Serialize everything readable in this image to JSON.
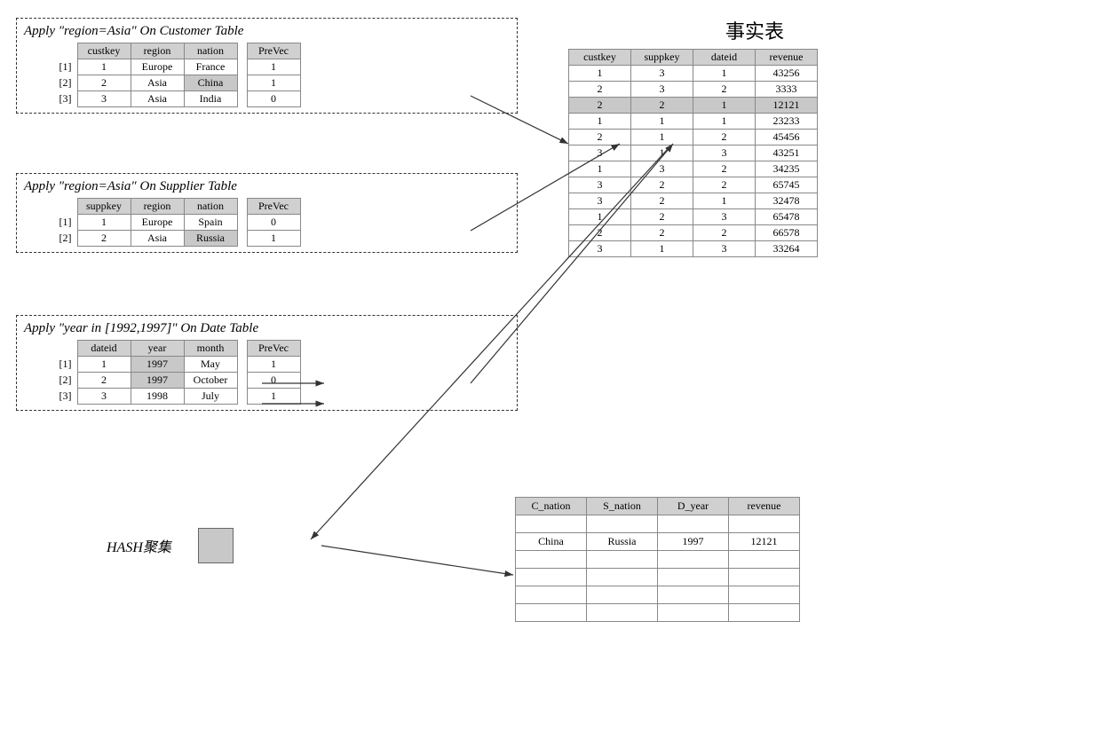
{
  "title_zh": "事实表",
  "sections": {
    "customer": {
      "title": "Apply  \"region=Asia\"  On Customer Table",
      "columns": [
        "custkey",
        "region",
        "nation"
      ],
      "prevec_header": "PreVec",
      "rows": [
        {
          "idx": "[1]",
          "custkey": "1",
          "region": "Europe",
          "nation": "France",
          "prevec": "1",
          "nation_shaded": false
        },
        {
          "idx": "[2]",
          "custkey": "2",
          "region": "Asia",
          "nation": "China",
          "prevec": "1",
          "nation_shaded": true
        },
        {
          "idx": "[3]",
          "custkey": "3",
          "region": "Asia",
          "nation": "India",
          "prevec": "0",
          "nation_shaded": false
        }
      ]
    },
    "supplier": {
      "title": "Apply  \"region=Asia\"  On Supplier Table",
      "columns": [
        "suppkey",
        "region",
        "nation"
      ],
      "prevec_header": "PreVec",
      "rows": [
        {
          "idx": "[1]",
          "suppkey": "1",
          "region": "Europe",
          "nation": "Spain",
          "prevec": "0",
          "nation_shaded": false
        },
        {
          "idx": "[2]",
          "suppkey": "2",
          "region": "Asia",
          "nation": "Russia",
          "prevec": "1",
          "nation_shaded": true
        }
      ]
    },
    "date": {
      "title": "Apply  \"year in [1992,1997]\"  On Date Table",
      "columns": [
        "dateid",
        "year",
        "month"
      ],
      "prevec_header": "PreVec",
      "rows": [
        {
          "idx": "[1]",
          "dateid": "1",
          "year": "1997",
          "month": "May",
          "prevec": "1",
          "year_shaded": true
        },
        {
          "idx": "[2]",
          "dateid": "2",
          "year": "1997",
          "month": "October",
          "prevec": "0",
          "year_shaded": true
        },
        {
          "idx": "[3]",
          "dateid": "3",
          "year": "1998",
          "month": "July",
          "prevec": "1",
          "year_shaded": false
        }
      ]
    }
  },
  "fact_table": {
    "columns": [
      "custkey",
      "suppkey",
      "dateid",
      "revenue"
    ],
    "rows": [
      {
        "custkey": "1",
        "suppkey": "3",
        "dateid": "1",
        "revenue": "43256",
        "shaded": false
      },
      {
        "custkey": "2",
        "suppkey": "3",
        "dateid": "2",
        "revenue": "3333",
        "shaded": false
      },
      {
        "custkey": "2",
        "suppkey": "2",
        "dateid": "1",
        "revenue": "12121",
        "shaded": true
      },
      {
        "custkey": "1",
        "suppkey": "1",
        "dateid": "1",
        "revenue": "23233",
        "shaded": false
      },
      {
        "custkey": "2",
        "suppkey": "1",
        "dateid": "2",
        "revenue": "45456",
        "shaded": false
      },
      {
        "custkey": "3",
        "suppkey": "1",
        "dateid": "3",
        "revenue": "43251",
        "shaded": false
      },
      {
        "custkey": "1",
        "suppkey": "3",
        "dateid": "2",
        "revenue": "34235",
        "shaded": false
      },
      {
        "custkey": "3",
        "suppkey": "2",
        "dateid": "2",
        "revenue": "65745",
        "shaded": false
      },
      {
        "custkey": "3",
        "suppkey": "2",
        "dateid": "1",
        "revenue": "32478",
        "shaded": false
      },
      {
        "custkey": "1",
        "suppkey": "2",
        "dateid": "3",
        "revenue": "65478",
        "shaded": false
      },
      {
        "custkey": "2",
        "suppkey": "2",
        "dateid": "2",
        "revenue": "66578",
        "shaded": false
      },
      {
        "custkey": "3",
        "suppkey": "1",
        "dateid": "3",
        "revenue": "33264",
        "shaded": false
      }
    ]
  },
  "hash_label": "HASH聚集",
  "result_table": {
    "columns": [
      "C_nation",
      "S_nation",
      "D_year",
      "revenue"
    ],
    "rows": [
      {
        "c_nation": "",
        "s_nation": "",
        "d_year": "",
        "revenue": ""
      },
      {
        "c_nation": "China",
        "s_nation": "Russia",
        "d_year": "1997",
        "revenue": "12121"
      },
      {
        "c_nation": "",
        "s_nation": "",
        "d_year": "",
        "revenue": ""
      },
      {
        "c_nation": "",
        "s_nation": "",
        "d_year": "",
        "revenue": ""
      },
      {
        "c_nation": "",
        "s_nation": "",
        "d_year": "",
        "revenue": ""
      },
      {
        "c_nation": "",
        "s_nation": "",
        "d_year": "",
        "revenue": ""
      }
    ]
  }
}
